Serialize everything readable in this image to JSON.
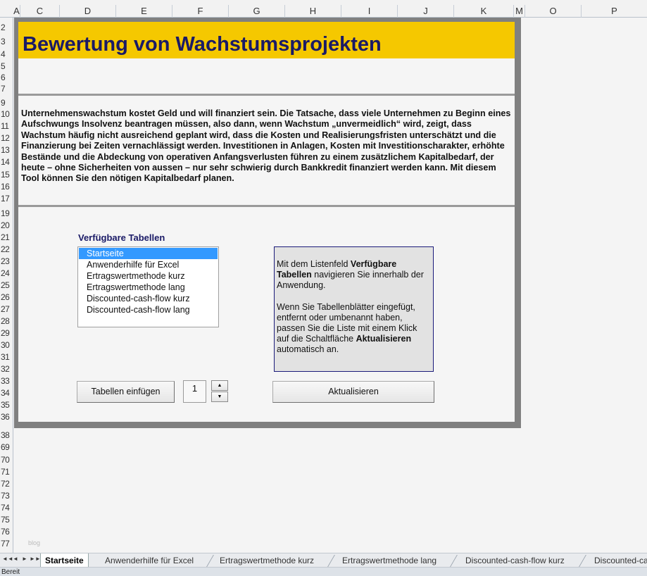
{
  "columns": [
    "A",
    "C",
    "D",
    "E",
    "F",
    "G",
    "H",
    "I",
    "J",
    "K",
    "M",
    "O",
    "P"
  ],
  "rows": [
    "2",
    "3",
    "4",
    "5",
    "6",
    "7",
    "9",
    "10",
    "11",
    "12",
    "13",
    "14",
    "15",
    "16",
    "17",
    "19",
    "20",
    "21",
    "22",
    "23",
    "24",
    "25",
    "26",
    "27",
    "28",
    "29",
    "30",
    "31",
    "32",
    "33",
    "34",
    "35",
    "36",
    "38",
    "69",
    "70",
    "71",
    "72",
    "73",
    "74",
    "75",
    "76",
    "77"
  ],
  "title": "Bewertung von Wachstumsprojekten",
  "description": "Unternehmenswachstum kostet Geld und will finanziert sein. Die Tatsache, dass viele Unternehmen zu Beginn eines Aufschwungs Insolvenz beantragen müssen, also dann, wenn Wachstum „unvermeidlich“ wird, zeigt, dass Wachstum häufig nicht ausreichend geplant wird, dass die Kosten und Realisierungsfristen unterschätzt und die Finanzierung bei Zeiten vernachlässigt werden. Investitionen in Anlagen, Kosten mit Investitionscharakter, erhöhte Bestände und die Abdeckung von operativen Anfangsverlusten führen zu einem zusätzlichem Kapitalbedarf, der heute – ohne Sicherheiten von aussen – nur sehr schwierig durch Bankkredit finanziert werden kann. Mit diesem Tool können Sie den nötigen Kapitalbedarf planen.",
  "list": {
    "title": "Verfügbare Tabellen",
    "items": [
      "Startseite",
      "Anwenderhilfe für Excel",
      "Ertragswertmethode kurz",
      "Ertragswertmethode lang",
      "Discounted-cash-flow kurz",
      "Discounted-cash-flow lang"
    ],
    "selected": "Startseite"
  },
  "info": {
    "p1_a": "Mit dem Listenfeld ",
    "p1_b": "Verfügbare Tabellen",
    "p1_c": " navigieren Sie innerhalb der Anwendung.",
    "p2_a": "Wenn Sie Tabellenblätter eingefügt, entfernt oder umbenannt haben, passen Sie die Liste mit einem Klick auf die Schaltfläche ",
    "p2_b": "Aktualisieren",
    "p2_c": " automatisch an."
  },
  "buttons": {
    "insert": "Tabellen einfügen",
    "update": "Aktualisieren"
  },
  "spinner": {
    "value": "1",
    "up": "▲",
    "down": "▼"
  },
  "watermark": "blog",
  "tab_nav": [
    "◄◄",
    "◄",
    "►",
    "►►"
  ],
  "sheet_tabs": [
    "Startseite",
    "Anwenderhilfe für Excel",
    "Ertragswertmethode kurz",
    "Ertragswertmethode lang",
    "Discounted-cash-flow kurz",
    "Discounted-ca"
  ],
  "active_tab": "Startseite",
  "status": "Bereit",
  "colors": {
    "title_bar": "#f5c800",
    "title_text": "#1a1a66",
    "selection": "#3399ff"
  }
}
